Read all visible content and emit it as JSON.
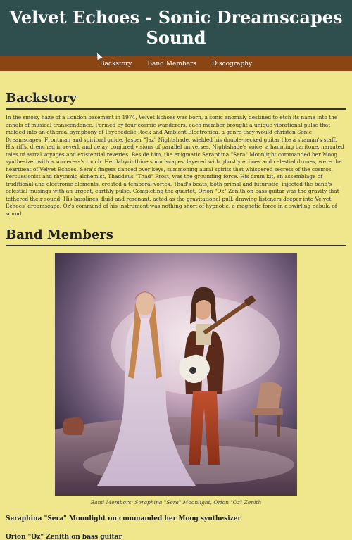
{
  "header": {
    "title": "Velvet Echoes - Sonic Dreamscapes Sound"
  },
  "nav": {
    "items": [
      {
        "label": "Backstory"
      },
      {
        "label": "Band Members"
      },
      {
        "label": "Discography"
      }
    ]
  },
  "backstory": {
    "heading": "Backstory",
    "text": "In the smoky haze of a London basement in 1974, Velvet Echoes was born, a sonic anomaly destined to etch its name into the annals of musical transcendence. Formed by four cosmic wanderers, each member brought a unique vibrational pulse that melded into an ethereal symphony of Psychedelic Rock and Ambient Electronica, a genre they would christen Sonic Dreamscapes. Frontman and spiritual guide, Jasper \"Jaz\" Nightshade, wielded his double-necked guitar like a shaman's staff. His riffs, drenched in reverb and delay, conjured visions of parallel universes. Nightshade's voice, a haunting baritone, narrated tales of astral voyages and existential reveries. Beside him, the enigmatic Seraphina \"Sera\" Moonlight commanded her Moog synthesizer with a sorceress's touch. Her labyrinthine soundscapes, layered with ghostly echoes and celestial drones, were the heartbeat of Velvet Echoes. Sera's fingers danced over keys, summoning aural spirits that whispered secrets of the cosmos. Percussionist and rhythmic alchemist, Thaddeus \"Thad\" Frost, was the grounding force. His drum kit, an assemblage of traditional and electronic elements, created a temporal vortex. Thad's beats, both primal and futuristic, injected the band's celestial musings with an urgent, earthly pulse. Completing the quartet, Orion \"Oz\" Zenith on bass guitar was the gravity that tethered their sound. His basslines, fluid and resonant, acted as the gravitational pull, drawing listeners deeper into Velvet Echoes' dreamscape. Oz's command of his instrument was nothing short of hypnotic, a magnetic force in a swirling nebula of sound."
  },
  "members": {
    "heading": "Band Members",
    "caption": "Band Members: Seraphina \"Sera\" Moonlight, Orion \"Oz\" Zenith",
    "lines": [
      "Seraphina \"Sera\" Moonlight on commanded her Moog synthesizer",
      "Orion \"Oz\" Zenith on bass guitar"
    ]
  },
  "colors": {
    "page_bg": "#f0e68c",
    "header_bg": "#2f4f4f",
    "nav_bg": "#8b4513"
  }
}
